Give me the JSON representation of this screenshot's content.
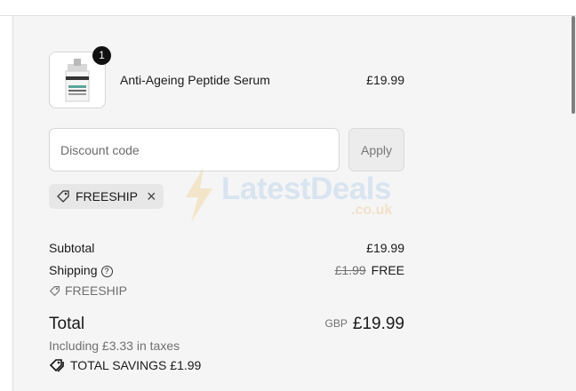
{
  "product": {
    "name": "Anti-Ageing Peptide Serum",
    "price": "£19.99",
    "quantity": "1",
    "image_label": "The Ordinary serum bottle thumbnail"
  },
  "discount": {
    "placeholder": "Discount code",
    "apply_label": "Apply",
    "applied_code": "FREESHIP"
  },
  "summary": {
    "subtotal_label": "Subtotal",
    "subtotal_value": "£19.99",
    "shipping_label": "Shipping",
    "shipping_original": "£1.99",
    "shipping_value": "FREE",
    "shipping_code": "FREESHIP",
    "total_label": "Total",
    "currency": "GBP",
    "total_value": "£19.99",
    "tax_note": "Including £3.33 in taxes",
    "savings": "TOTAL SAVINGS £1.99"
  },
  "watermark": {
    "text": "LatestDeals",
    "sub": ".co.uk"
  },
  "colors": {
    "background": "#f5f5f5",
    "chip": "#e7e7e7",
    "badge": "#111111"
  },
  "icons": [
    "tag-icon",
    "close-icon",
    "help-icon",
    "savings-tag-icon"
  ]
}
